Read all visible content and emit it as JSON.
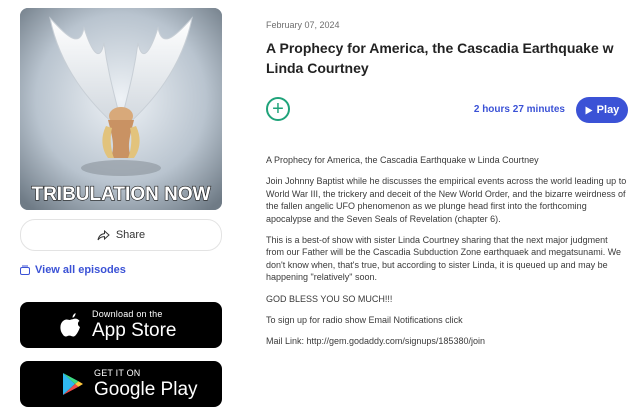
{
  "cover": {
    "overlay_text": "TRIBULATION NOW"
  },
  "share": {
    "label": "Share"
  },
  "view_all": {
    "label": "View all episodes"
  },
  "app_store": {
    "small": "Download on the",
    "big": "App Store"
  },
  "google_play": {
    "small": "GET IT ON",
    "big": "Google Play"
  },
  "episode": {
    "date": "February 07, 2024",
    "title": "A Prophecy for America, the Cascadia Earthquake w Linda Courtney",
    "duration": "2 hours 27 minutes",
    "play_label": "Play",
    "description": [
      "A Prophecy for America, the Cascadia Earthquake w Linda Courtney",
      "Join Johnny Baptist while he discusses the empirical events across the world leading up to World War III, the trickery and deceit of the New World Order, and the bizarre weirdness of the fallen angelic UFO phenomenon as we plunge head first into the forthcoming apocalypse and the Seven Seals of Revelation (chapter 6).",
      "This is a best-of show with sister Linda Courtney sharing that the next major judgment from our Father will be the Cascadia Subduction Zone earthquaek and megatsunami.  We don't know when, that's true, but according to sister Linda, it is queued up and may be happening \"relatively\" soon.",
      "GOD BLESS YOU SO MUCH!!!",
      "To sign up for radio show Email Notifications click",
      "Mail Link: http://gem.godaddy.com/signups/185380/join"
    ]
  },
  "colors": {
    "accent": "#3b52d6",
    "add": "#1fa37a"
  }
}
